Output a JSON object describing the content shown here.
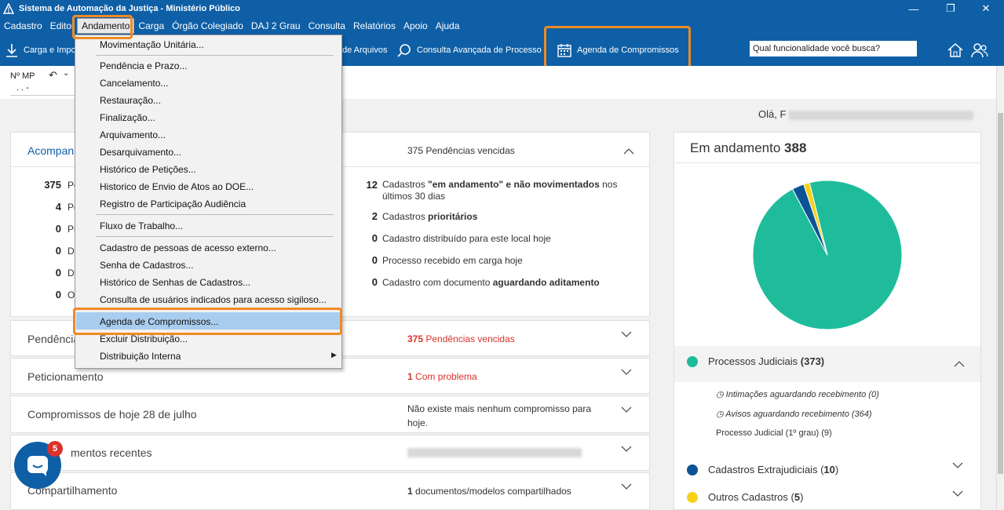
{
  "window": {
    "title": "Sistema de Automação da Justiça - Ministério Público"
  },
  "menubar": {
    "items": [
      "Cadastro",
      "Editor",
      "Andamento",
      "Carga",
      "Órgão Colegiado",
      "DAJ 2 Grau",
      "Consulta",
      "Relatórios",
      "Apoio",
      "Ajuda"
    ],
    "active": "Andamento"
  },
  "toolbar": {
    "carga": "Carga e Impo",
    "arquivos": "de Arquivos",
    "consulta_avancada": "Consulta Avançada de Processo",
    "agenda": "Agenda de Compromissos",
    "search_placeholder": "Qual funcionalidade você busca?"
  },
  "subbar": {
    "field_label": "Nº MP",
    "field_value": ".   .   -"
  },
  "greeting": "Olá, F",
  "dropdown": {
    "items": [
      "Movimentação Unitária...",
      "Pendência e Prazo...",
      "Cancelamento...",
      "Restauração...",
      "Finalização...",
      "Arquivamento...",
      "Desarquivamento...",
      "Histórico de Petições...",
      "Historico de Envio de Atos ao DOE...",
      "Registro de Participação Audiência",
      "Fluxo de Trabalho...",
      "Cadastro de pessoas de acesso externo...",
      "Senha de Cadastros...",
      "Histórico de Senhas de Cadastros...",
      "Consulta de usuários indicados para acesso sigiloso...",
      "Agenda de Compromissos...",
      "Excluir Distribuição...",
      "Distribuição Interna"
    ],
    "selected": "Agenda de Compromissos..."
  },
  "acompanhamento": {
    "title": "Acompan",
    "summary": "375 Pendências vencidas",
    "left": [
      {
        "n": "375",
        "label": "Pe"
      },
      {
        "n": "4",
        "label": "Pe"
      },
      {
        "n": "0",
        "label": "Pr"
      },
      {
        "n": "0",
        "label": "D"
      },
      {
        "n": "0",
        "label": "D"
      },
      {
        "n": "0",
        "label": "O"
      }
    ],
    "right": [
      {
        "n": "12",
        "pre": "Cadastros ",
        "bold": "\"em andamento\" e não movimentados",
        "post": " nos",
        "line2": "últimos 30 dias"
      },
      {
        "n": "2",
        "pre": "Cadastros ",
        "bold": "prioritários",
        "post": ""
      },
      {
        "n": "0",
        "pre": "Cadastro distribuído para este local hoje",
        "bold": "",
        "post": ""
      },
      {
        "n": "0",
        "pre": "Processo recebido em carga hoje",
        "bold": "",
        "post": ""
      },
      {
        "n": "0",
        "pre": "Cadastro com documento ",
        "bold": "aguardando aditamento",
        "post": ""
      }
    ]
  },
  "sections": [
    {
      "title": "Pendência",
      "num": "375",
      "text": " Pendências vencidas",
      "red": true
    },
    {
      "title": "Peticionamento",
      "num": "1",
      "text": " Com problema",
      "red": true
    },
    {
      "title": "Compromissos de hoje 28 de julho",
      "num": "",
      "text": "Não existe mais nenhum compromisso para hoje.",
      "red": false
    },
    {
      "title": "mentos recentes",
      "num": "",
      "text": "",
      "red": false
    },
    {
      "title": "Compartilhamento",
      "num": "1",
      "text": " documentos/modelos compartilhados",
      "red": false
    }
  ],
  "andamento": {
    "title": "Em andamento",
    "total": "388",
    "legend": [
      {
        "label": "Processos Judiciais",
        "count": "(373)",
        "color": "#1fbc9c"
      },
      {
        "label": "Cadastros Extrajudiciais",
        "count": "10",
        "color": "#0b5394"
      },
      {
        "label": "Outros Cadastros",
        "count": "5",
        "color": "#f5d218"
      }
    ],
    "details": [
      "Intimações aguardando recebimento (0)",
      "Avisos aguardando recebimento (364)",
      "Processo Judicial (1º grau) (9)"
    ]
  },
  "chart_data": {
    "type": "pie",
    "categories": [
      "Processos Judiciais",
      "Cadastros Extrajudiciais",
      "Outros Cadastros"
    ],
    "values": [
      373,
      10,
      5
    ],
    "colors": [
      "#1fbc9c",
      "#0b5394",
      "#f5d218"
    ]
  },
  "chat": {
    "badge": "5"
  }
}
